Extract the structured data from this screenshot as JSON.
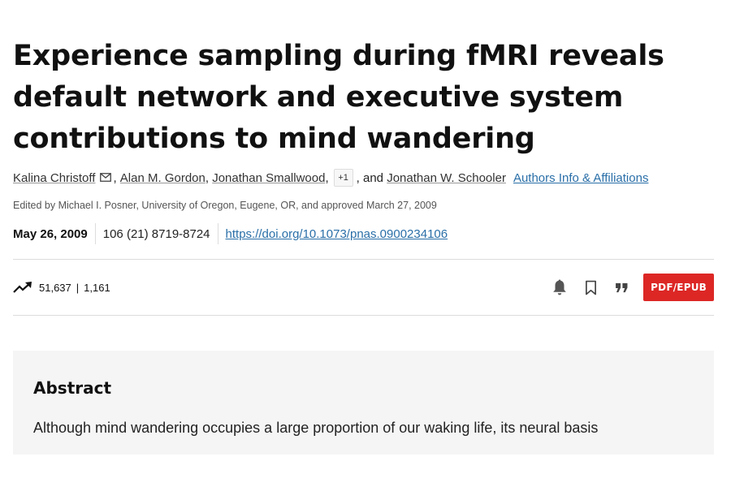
{
  "article": {
    "title": "Experience sampling during fMRI reveals default network and executive system contributions to mind wandering",
    "authors": [
      {
        "name": "Kalina Christoff",
        "has_email": true
      },
      {
        "name": "Alan M. Gordon"
      },
      {
        "name": "Jonathan Smallwood"
      },
      {
        "name": "Jonathan W. Schooler"
      }
    ],
    "more_authors_badge": "+1",
    "and_text": ", and",
    "authors_info_link": "Authors Info & Affiliations",
    "edited_by": "Edited by Michael I. Posner, University of Oregon, Eugene, OR, and approved March 27, 2009",
    "date": "May 26, 2009",
    "citation": "106 (21) 8719-8724",
    "doi": "https://doi.org/10.1073/pnas.0900234106"
  },
  "metrics": {
    "views": "51,637",
    "separator": "|",
    "citations": "1,161",
    "icon": "trending-up-icon"
  },
  "actions": {
    "alert_icon": "bell-icon",
    "bookmark_icon": "bookmark-icon",
    "cite_icon": "quote-icon",
    "pdf_label": "PDF/EPUB",
    "pdf_color": "#dc2725"
  },
  "abstract": {
    "heading": "Abstract",
    "text": "Although mind wandering occupies a large proportion of our waking life, its neural basis"
  },
  "colors": {
    "link": "#2a6fa8",
    "abstract_bg": "#f5f5f5"
  }
}
